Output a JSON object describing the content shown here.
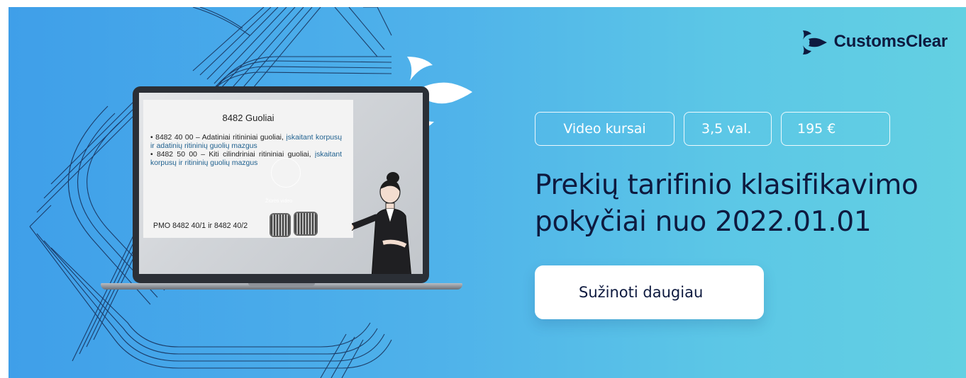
{
  "brand": {
    "name": "CustomsClear"
  },
  "tags": [
    {
      "label": "Video kursai"
    },
    {
      "label": "3,5 val."
    },
    {
      "label": "195 €"
    }
  ],
  "headline": {
    "line1": "Prekių tarifinio klasifikavimo",
    "line2": "pokyčiai nuo 2022.01.01"
  },
  "cta": {
    "label": "Sužinoti daugiau"
  },
  "slide": {
    "title": "8482 Guoliai",
    "item1_black": "• 8482 40 00 – Adatiniai ritininiai guoliai,",
    "item1_blue": "įskaitant korpusų ir adatinių ritininių guolių mazgus",
    "item2_black": "• 8482 50 00 – Kiti cilindriniai ritininiai guoliai,",
    "item2_blue": "įskaitant korpusų ir ritininių guolių mazgus",
    "pmo": "PMO 8482 40/1 ir 8482 40/2",
    "overlay": "Žiūrėti video"
  },
  "colors": {
    "gradient_start": "#3f9fe9",
    "gradient_end": "#63d0e2",
    "headline": "#0e1a3f",
    "cta_bg": "#ffffff",
    "slide_blue": "#1d5f8e"
  },
  "icons": {
    "logo": "customsclear-arrow-icon",
    "swoosh": "brand-arrow-swoosh-icon"
  }
}
